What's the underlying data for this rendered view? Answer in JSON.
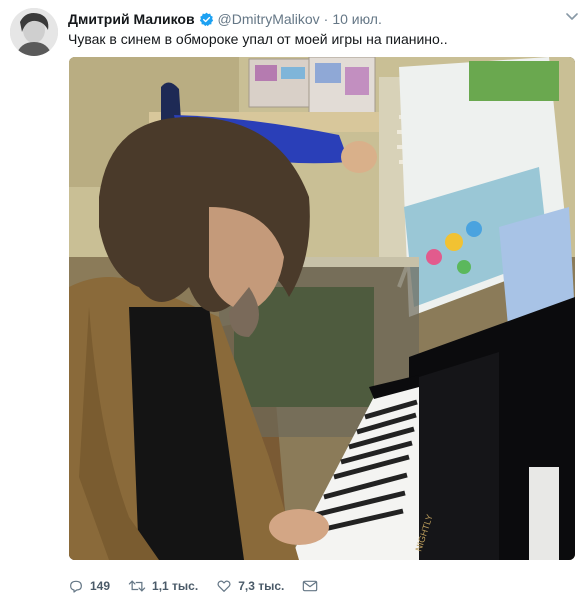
{
  "tweet": {
    "display_name": "Дмитрий Маликов",
    "handle": "@DmitryMalikov",
    "separator": "·",
    "date": "10 июл.",
    "text": "Чувак в синем в обмороке упал от моей игры на пианино.."
  },
  "actions": {
    "reply_count": "149",
    "retweet_count": "1,1 тыс.",
    "like_count": "7,3 тыс."
  },
  "colors": {
    "verified": "#1da1f2",
    "secondary_text": "#657786",
    "primary_text": "#14171a"
  },
  "icons": {
    "verified": "verified-badge-icon",
    "menu": "chevron-down-icon",
    "reply": "reply-icon",
    "retweet": "retweet-icon",
    "like": "heart-icon",
    "message": "envelope-icon"
  }
}
